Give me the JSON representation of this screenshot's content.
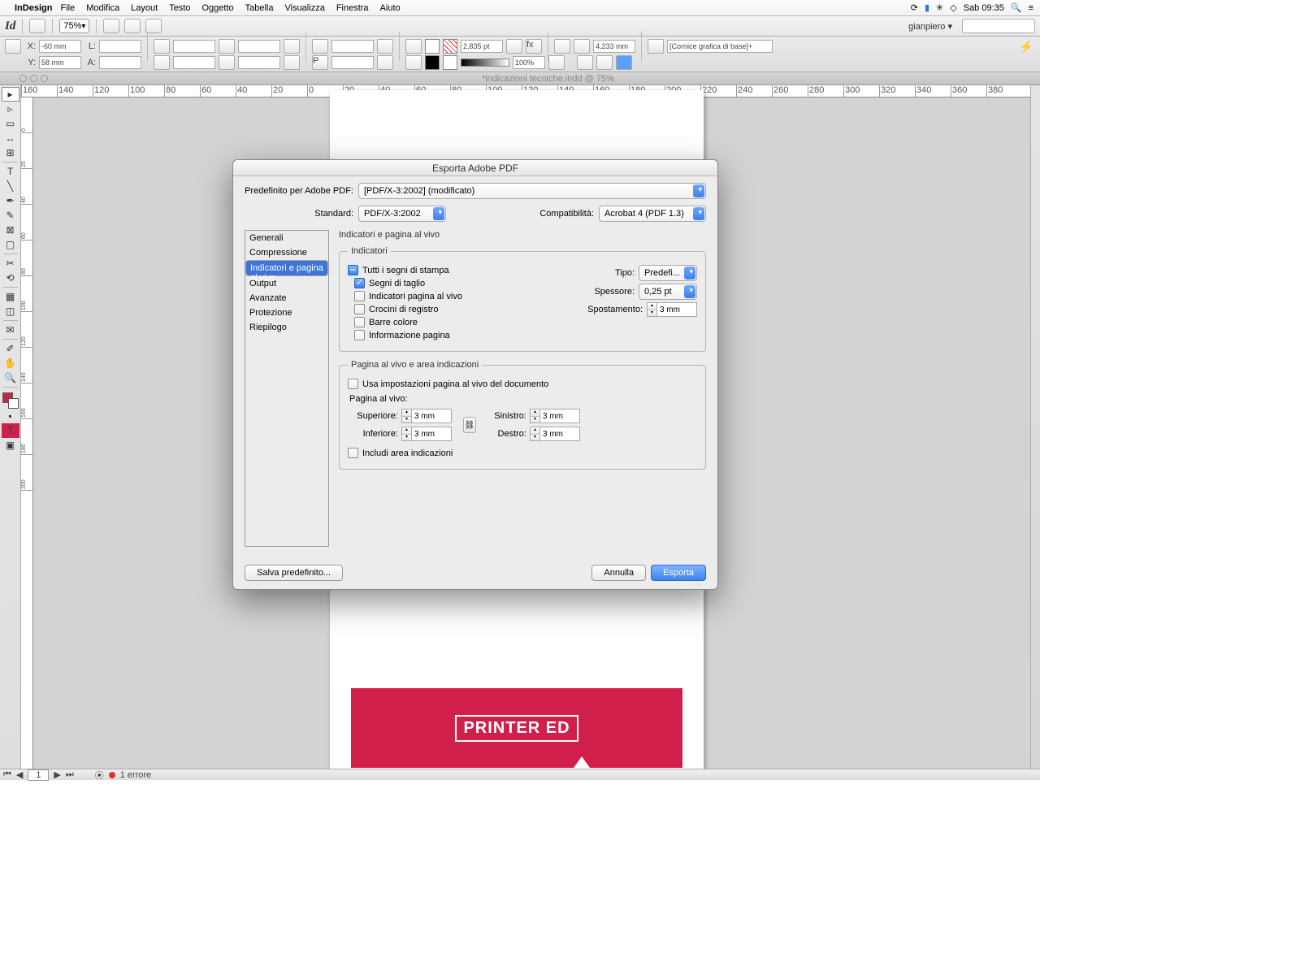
{
  "menubar": {
    "app": "InDesign",
    "items": [
      "File",
      "Modifica",
      "Layout",
      "Testo",
      "Oggetto",
      "Tabella",
      "Visualizza",
      "Finestra",
      "Aiuto"
    ],
    "clock": "Sab 09:35"
  },
  "idbar": {
    "zoom": "75%",
    "user": "gianpiero"
  },
  "ctrl": {
    "x": "-60 mm",
    "y": "58 mm",
    "l": "",
    "a": "",
    "stroke1": "2,835 pt",
    "stroke2": "4,233 mm",
    "pct": "100%",
    "style": "[Cornice grafica di base]+"
  },
  "doc": {
    "tab": "*indicazioni tecniche.indd @ 75%"
  },
  "ruler": {
    "h": [
      "160",
      "140",
      "120",
      "100",
      "80",
      "60",
      "40",
      "20",
      "0",
      "20",
      "40",
      "60",
      "80",
      "100",
      "120",
      "140",
      "160",
      "180",
      "200",
      "220",
      "240",
      "260",
      "280",
      "300",
      "320",
      "340",
      "360",
      "380"
    ],
    "v": [
      "0",
      "20",
      "40",
      "60",
      "80",
      "100",
      "120",
      "140",
      "160",
      "180",
      "200"
    ]
  },
  "page": {
    "logo": "PRINTER ED"
  },
  "status": {
    "page": "1",
    "err": "1 errore"
  },
  "dialog": {
    "title": "Esporta Adobe PDF",
    "preset_label": "Predefinito per Adobe PDF:",
    "preset_value": "[PDF/X-3:2002] (modificato)",
    "standard_label": "Standard:",
    "standard_value": "PDF/X-3:2002",
    "compat_label": "Compatibilità:",
    "compat_value": "Acrobat 4 (PDF 1.3)",
    "side": [
      "Generali",
      "Compressione",
      "Indicatori e pagina al vivo",
      "Output",
      "Avanzate",
      "Protezione",
      "Riepilogo"
    ],
    "heading": "Indicatori e pagina al vivo",
    "fs1": {
      "legend": "Indicatori",
      "all": "Tutti i segni di stampa",
      "c1": "Segni di taglio",
      "c2": "Indicatori pagina al vivo",
      "c3": "Crocini di registro",
      "c4": "Barre colore",
      "c5": "Informazione pagina",
      "tipo_l": "Tipo:",
      "tipo_v": "Predefi...",
      "spess_l": "Spessore:",
      "spess_v": "0,25 pt",
      "spost_l": "Spostamento:",
      "spost_v": "3 mm"
    },
    "fs2": {
      "legend": "Pagina al vivo e area indicazioni",
      "usedoc": "Usa impostazioni pagina al vivo del documento",
      "sub": "Pagina al vivo:",
      "sup_l": "Superiore:",
      "sup_v": "3 mm",
      "inf_l": "Inferiore:",
      "inf_v": "3 mm",
      "sin_l": "Sinistro:",
      "sin_v": "3 mm",
      "des_l": "Destro:",
      "des_v": "3 mm",
      "slug": "Includi area indicazioni"
    },
    "buttons": {
      "save": "Salva predefinito...",
      "cancel": "Annulla",
      "export": "Esporta"
    }
  }
}
